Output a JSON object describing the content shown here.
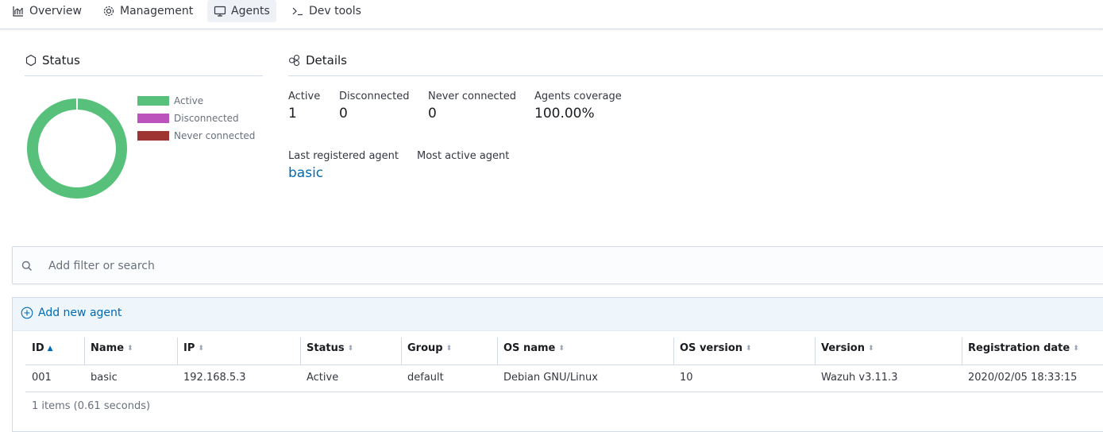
{
  "nav": {
    "items": [
      {
        "label": "Overview",
        "icon": "chart-icon"
      },
      {
        "label": "Management",
        "icon": "gear-icon"
      },
      {
        "label": "Agents",
        "icon": "monitor-icon"
      },
      {
        "label": "Dev tools",
        "icon": "terminal-icon"
      }
    ],
    "selected": "Agents"
  },
  "status": {
    "title": "Status",
    "legend": [
      {
        "label": "Active",
        "color": "#57c17b"
      },
      {
        "label": "Disconnected",
        "color": "#bc52bc"
      },
      {
        "label": "Never connected",
        "color": "#9e3533"
      }
    ],
    "chart_data": {
      "type": "pie",
      "categories": [
        "Active",
        "Disconnected",
        "Never connected"
      ],
      "values": [
        1,
        0,
        0
      ],
      "colors": [
        "#57c17b",
        "#bc52bc",
        "#9e3533"
      ]
    }
  },
  "details": {
    "title": "Details",
    "stats": [
      {
        "label": "Active",
        "value": "1"
      },
      {
        "label": "Disconnected",
        "value": "0"
      },
      {
        "label": "Never connected",
        "value": "0"
      },
      {
        "label": "Agents coverage",
        "value": "100.00%"
      }
    ],
    "last_registered": {
      "label": "Last registered agent",
      "value": "basic"
    },
    "most_active": {
      "label": "Most active agent",
      "value": ""
    }
  },
  "search": {
    "placeholder": "Add filter or search"
  },
  "table": {
    "add_label": "Add new agent",
    "columns": [
      "ID",
      "Name",
      "IP",
      "Status",
      "Group",
      "OS name",
      "OS version",
      "Version",
      "Registration date"
    ],
    "sorted_column": "ID",
    "rows": [
      [
        "001",
        "basic",
        "192.168.5.3",
        "Active",
        "default",
        "Debian GNU/Linux",
        "10",
        "Wazuh v3.11.3",
        "2020/02/05 18:33:15"
      ]
    ],
    "footer": "1 items (0.61 seconds)"
  }
}
